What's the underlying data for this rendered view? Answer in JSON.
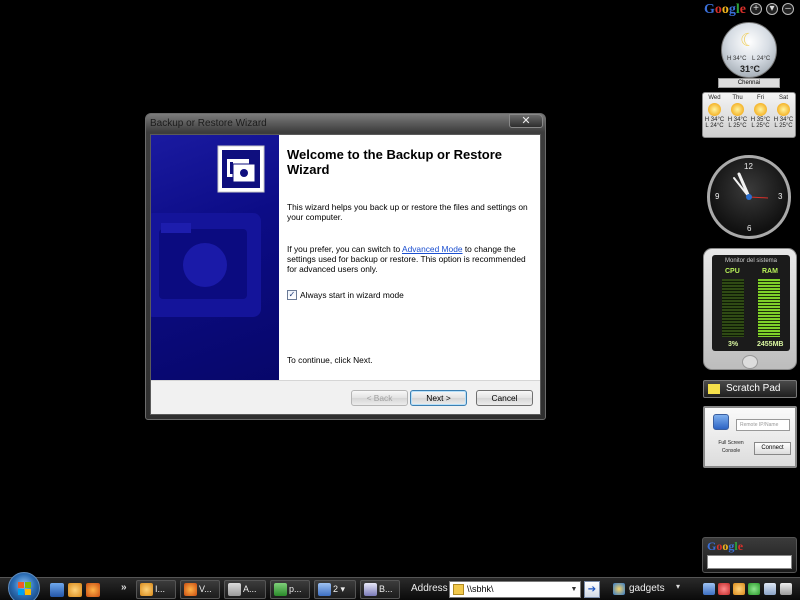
{
  "window": {
    "title": "Backup or Restore Wizard",
    "close_label": "✕"
  },
  "wizard": {
    "heading": "Welcome to the Backup or Restore Wizard",
    "intro": "This wizard helps you back up or restore the files and settings on your computer.",
    "switch_text_before": "If you prefer, you can switch to ",
    "advanced_link": "Advanced Mode",
    "switch_text_after": " to change the settings used for backup or restore. This option is recommended for advanced users only.",
    "checkbox_label": "Always start in wizard mode",
    "checkbox_checked": true,
    "continue_text": "To continue, click Next.",
    "back_label": "< Back",
    "next_label": "Next >",
    "cancel_label": "Cancel"
  },
  "sidebar": {
    "google_logo": [
      "G",
      "o",
      "o",
      "g",
      "l",
      "e"
    ],
    "controls": [
      "+",
      "▾",
      "–"
    ],
    "weather": {
      "hi": "H 34°C",
      "lo": "L 24°C",
      "temp": "31°C",
      "city": "Chennai",
      "forecast": [
        {
          "day": "Wed",
          "hi": "H 34°C",
          "lo": "L 24°C"
        },
        {
          "day": "Thu",
          "hi": "H 34°C",
          "lo": "L 25°C"
        },
        {
          "day": "Fri",
          "hi": "H 35°C",
          "lo": "L 25°C"
        },
        {
          "day": "Sat",
          "hi": "H 34°C",
          "lo": "L 25°C"
        }
      ]
    },
    "clock_numbers": [
      "12",
      "3",
      "6",
      "9"
    ],
    "monitor": {
      "title": "Monitor del sistema",
      "cpu_label": "CPU",
      "ram_label": "RAM",
      "cpu_value": "3%",
      "ram_value": "2455MB"
    },
    "scratch_pad": "Scratch Pad",
    "rdp": {
      "placeholder": "Remote IP/Name",
      "full_screen": "Full Screen",
      "console": "Console",
      "connect": "Connect"
    }
  },
  "taskbar": {
    "chevron": "»",
    "tasks": [
      "I...",
      "V...",
      "A...",
      "p...",
      "2",
      "B..."
    ],
    "address_label": "Address",
    "address_value": "\\\\sbhk\\",
    "go_arrow": "➔",
    "gadgets_label": "gadgets"
  },
  "colors": {
    "banner_blue": "#0c0c86",
    "link_blue": "#1b4fd0",
    "desktop": "#000000"
  }
}
